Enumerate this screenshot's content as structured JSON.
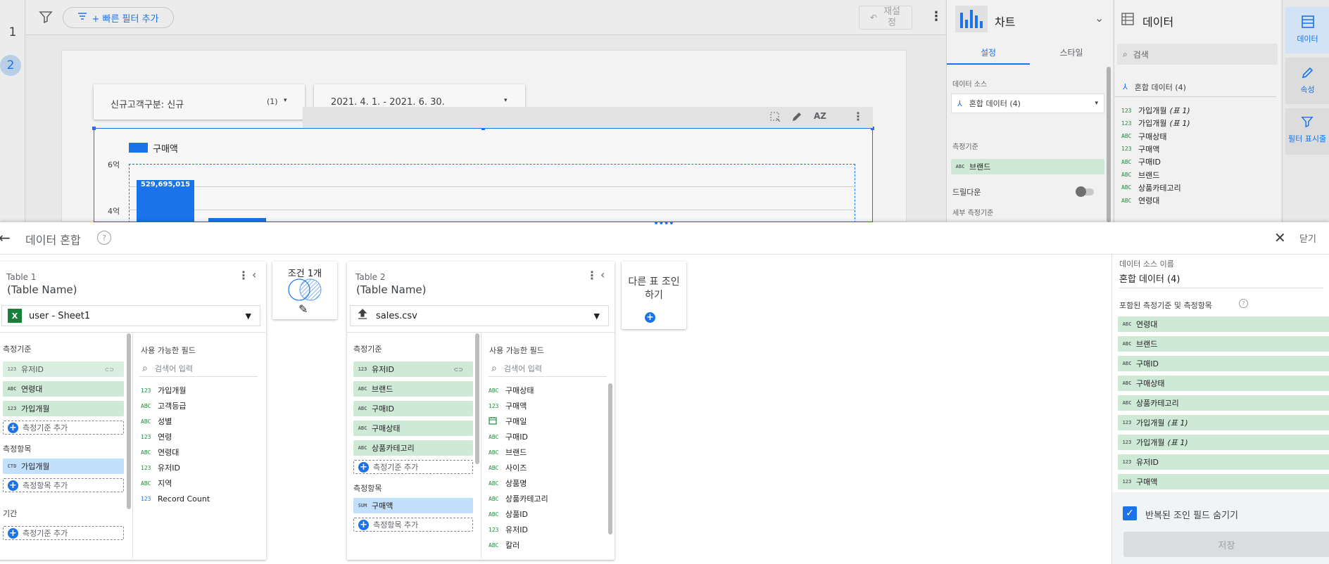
{
  "pages": [
    "1",
    "2"
  ],
  "toolbar": {
    "quick_filter": "+ 빠른 필터 추가",
    "reset": "재설정"
  },
  "canvas": {
    "filter1": {
      "label": "신규고객구분: 신규",
      "count": "(1)"
    },
    "filter2": {
      "label": "2021. 4. 1. - 2021. 6. 30."
    },
    "legend": "구매액",
    "y_ticks": [
      "6억",
      "4억"
    ],
    "bar_label": "529,695,015"
  },
  "chart_panel": {
    "title": "차트",
    "tabs": [
      "설정",
      "스타일"
    ],
    "data_source_label": "데이터 소스",
    "data_source": "혼합 데이터 (4)",
    "dimension_label": "측정기준",
    "dimension": "브랜드",
    "drilldown": "드릴다운",
    "sub_dimension": "세부 측정기준"
  },
  "data_panel": {
    "title": "데이터",
    "search_placeholder": "검색",
    "source": "혼합 데이터 (4)",
    "fields": [
      {
        "type": "123",
        "name": "가입개월",
        "suffix": "(표 1)"
      },
      {
        "type": "123",
        "name": "가입개월",
        "suffix": "(표 1)"
      },
      {
        "type": "ABC",
        "name": "구매상태",
        "suffix": ""
      },
      {
        "type": "123",
        "name": "구매액",
        "suffix": ""
      },
      {
        "type": "ABC",
        "name": "구매ID",
        "suffix": ""
      },
      {
        "type": "ABC",
        "name": "브랜드",
        "suffix": ""
      },
      {
        "type": "ABC",
        "name": "상품카테고리",
        "suffix": ""
      },
      {
        "type": "ABC",
        "name": "연령대",
        "suffix": ""
      }
    ]
  },
  "rail": {
    "data": "데이터",
    "props": "속성",
    "filter": "필터 표시줄"
  },
  "blend": {
    "title": "데이터 혼합",
    "close": "닫기",
    "table1": {
      "label": "Table 1",
      "name": "(Table Name)",
      "source": "user - Sheet1",
      "dim_label": "측정기준",
      "dims": [
        {
          "t": "123",
          "n": "유저ID"
        },
        {
          "t": "ABC",
          "n": "연령대"
        },
        {
          "t": "123",
          "n": "가입개월"
        }
      ],
      "add_dim": "측정기준 추가",
      "metric_label": "측정항목",
      "metrics": [
        {
          "t": "CTD",
          "n": "가입개월"
        }
      ],
      "add_metric": "측정항목 추가",
      "period_label": "기간",
      "add_period": "측정기준 추가",
      "avail_label": "사용 가능한 필드",
      "search_placeholder": "검색어 입력",
      "avail": [
        {
          "t": "123",
          "n": "가입개월"
        },
        {
          "t": "ABC",
          "n": "고객등급"
        },
        {
          "t": "ABC",
          "n": "성별"
        },
        {
          "t": "123",
          "n": "연령"
        },
        {
          "t": "ABC",
          "n": "연령대"
        },
        {
          "t": "123",
          "n": "유저ID"
        },
        {
          "t": "ABC",
          "n": "지역"
        },
        {
          "t": "123",
          "n": "Record Count"
        }
      ]
    },
    "join": {
      "label": "조건 1개"
    },
    "table2": {
      "label": "Table 2",
      "name": "(Table Name)",
      "source": "sales.csv",
      "dim_label": "측정기준",
      "dims": [
        {
          "t": "123",
          "n": "유저ID"
        },
        {
          "t": "ABC",
          "n": "브랜드"
        },
        {
          "t": "ABC",
          "n": "구매ID"
        },
        {
          "t": "ABC",
          "n": "구매상태"
        },
        {
          "t": "ABC",
          "n": "상품카테고리"
        }
      ],
      "add_dim": "측정기준 추가",
      "metric_label": "측정항목",
      "metrics": [
        {
          "t": "SUM",
          "n": "구매액"
        }
      ],
      "add_metric": "측정항목 추가",
      "avail_label": "사용 가능한 필드",
      "search_placeholder": "검색어 입력",
      "avail": [
        {
          "t": "ABC",
          "n": "구매상태"
        },
        {
          "t": "123",
          "n": "구매액"
        },
        {
          "t": "CAL",
          "n": "구매일"
        },
        {
          "t": "ABC",
          "n": "구매ID"
        },
        {
          "t": "ABC",
          "n": "브랜드"
        },
        {
          "t": "ABC",
          "n": "사이즈"
        },
        {
          "t": "ABC",
          "n": "상품명"
        },
        {
          "t": "ABC",
          "n": "상품카테고리"
        },
        {
          "t": "ABC",
          "n": "상품ID"
        },
        {
          "t": "123",
          "n": "유저ID"
        },
        {
          "t": "ABC",
          "n": "칼러"
        }
      ]
    },
    "another_join": "다른 표 조인하기",
    "right": {
      "name_label": "데이터 소스 이름",
      "name": "혼합 데이터 (4)",
      "included_label": "포함된 측정기준 및 측정항목",
      "fields": [
        {
          "t": "ABC",
          "n": "연령대",
          "s": ""
        },
        {
          "t": "ABC",
          "n": "브랜드",
          "s": ""
        },
        {
          "t": "ABC",
          "n": "구매ID",
          "s": ""
        },
        {
          "t": "ABC",
          "n": "구매상태",
          "s": ""
        },
        {
          "t": "ABC",
          "n": "상품카테고리",
          "s": ""
        },
        {
          "t": "123",
          "n": "가입개월",
          "s": "(표 1)"
        },
        {
          "t": "123",
          "n": "가입개월",
          "s": "(표 1)"
        },
        {
          "t": "123",
          "n": "유저ID",
          "s": ""
        },
        {
          "t": "123",
          "n": "구매액",
          "s": ""
        }
      ],
      "hide_dup": "반복된 조인 필드 숨기기",
      "save": "저장"
    }
  }
}
